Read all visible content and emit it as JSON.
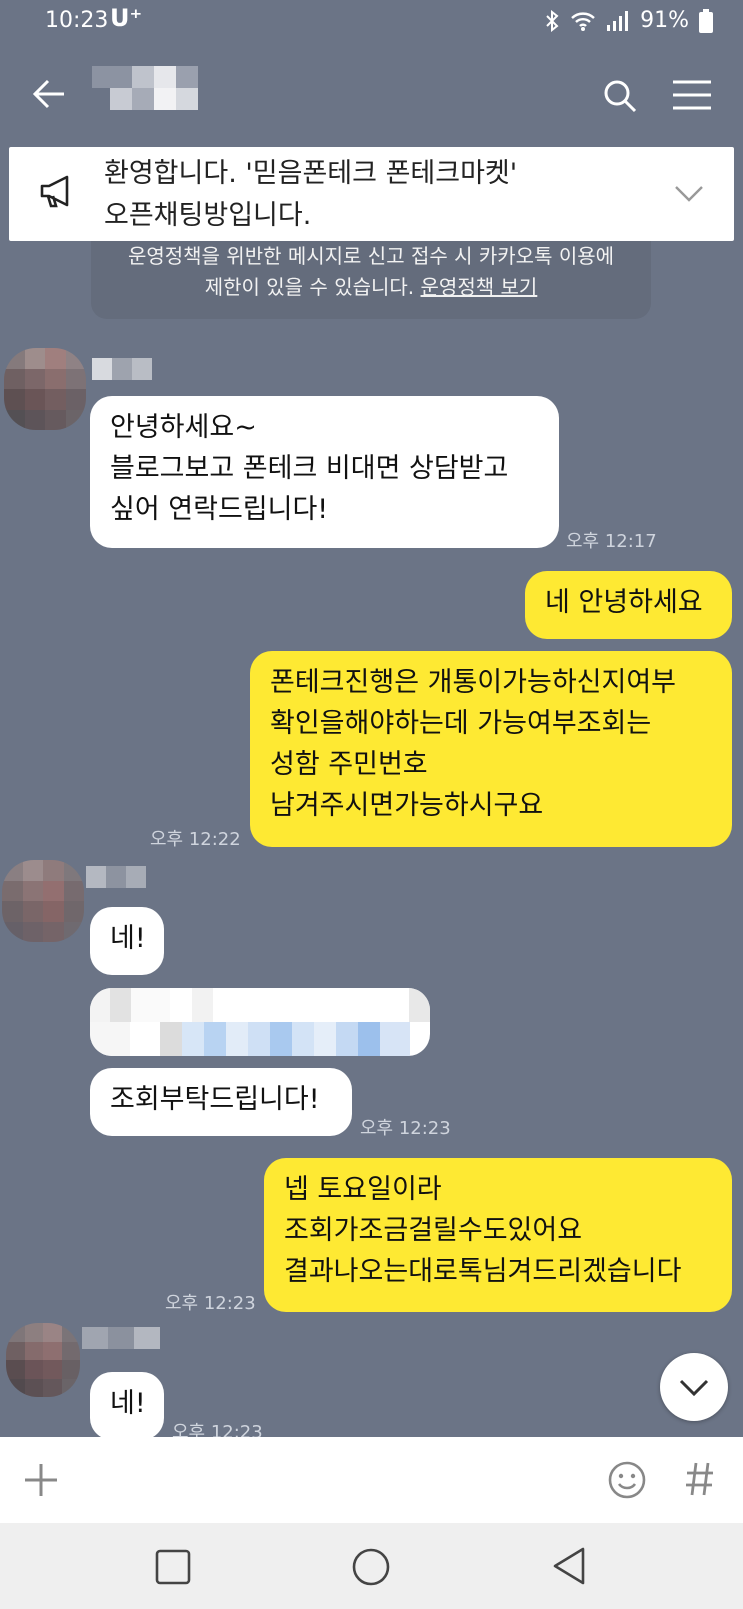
{
  "status_bar": {
    "time": "10:23",
    "carrier": "U⁺",
    "battery": "91%"
  },
  "header": {
    "title": ""
  },
  "notice": {
    "line1": "환영합니다. '믿음폰테크 폰테크마켓'",
    "line2": "오픈채팅방입니다."
  },
  "policy": {
    "line1": "운영정책을 위반한 메시지로 신고 접수 시 카카오톡 이용에",
    "line2": "제한이 있을 수 있습니다.",
    "link": "운영정책 보기"
  },
  "messages": {
    "m1": "안녕하세요~\n블로그보고 폰테크 비대면 상담받고\n싶어 연락드립니다!",
    "m1_time": "오후 12:17",
    "m2": "네 안녕하세요",
    "m3": "폰테크진행은 개통이가능하신지여부\n확인을해야하는데 가능여부조회는\n성함 주민번호\n남겨주시면가능하시구요",
    "m3_time": "오후 12:22",
    "m4": "네!",
    "m6": "조회부탁드립니다!",
    "m6_time": "오후 12:23",
    "m7": "넵 토요일이라\n조회가조금걸릴수도있어요\n결과나오는대로톡님겨드리겠습니다",
    "m7_time": "오후 12:23",
    "m8": "네!",
    "m8_time": "오후 12:23"
  },
  "colors": {
    "background": "#6b7486",
    "outgoing": "#fee933",
    "incoming": "#ffffff"
  }
}
